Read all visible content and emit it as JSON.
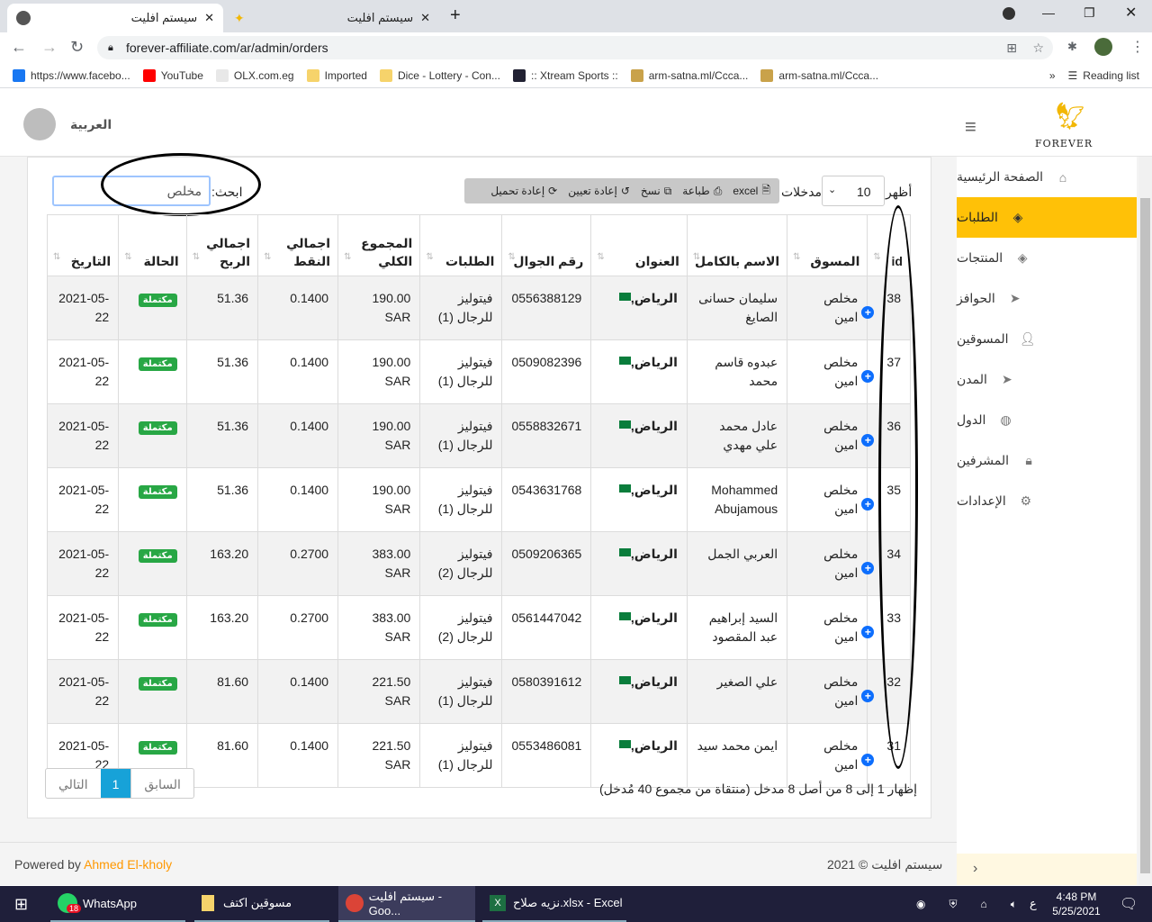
{
  "browser": {
    "tabs": [
      {
        "title": "سيستم افليت"
      },
      {
        "title": "سيستم افليت"
      }
    ],
    "url": "forever-affiliate.com/ar/admin/orders",
    "bookmarks": [
      "https://www.facebo...",
      "YouTube",
      "OLX.com.eg",
      "Imported",
      "Dice - Lottery - Con...",
      ":: Xtream Sports ::",
      "arm-satna.ml/Ccca...",
      "arm-satna.ml/Ccca..."
    ],
    "reading_list": "Reading list"
  },
  "header": {
    "language": "العربية",
    "logo_text": "FOREVER"
  },
  "sidebar": {
    "items": [
      "الصفحة الرئيسية",
      "الطلبات",
      "المنتجات",
      "الحوافز",
      "المسوقين",
      "المدن",
      "الدول",
      "المشرفين",
      "الإعدادات"
    ],
    "active_index": 1
  },
  "toolbar": {
    "show_label": "أظهر",
    "entries_value": "10",
    "entries_label": "مدخلات",
    "buttons": [
      "excel",
      "طباعة",
      "نسخ",
      "إعادة تعيين",
      "إعادة تحميل"
    ],
    "search_label": "ابحث:",
    "search_value": "مخلص"
  },
  "table": {
    "headers": [
      "id",
      "المسوق",
      "الاسم بالكامل",
      "العنوان",
      "رقم الجوال",
      "الطلبات",
      "المجموع الكلي",
      "اجمالي النقط",
      "اجمالي الربح",
      "الحالة",
      "التاريخ"
    ],
    "rows": [
      [
        "38",
        "مخلص امين",
        "سليمان حسانى الصايغ",
        "الرياض,",
        "0556388129",
        "فيتوليز للرجال (1)",
        "190.00 SAR",
        "0.1400",
        "51.36",
        "مكتملة",
        "2021-05-22"
      ],
      [
        "37",
        "مخلص امين",
        "عبدوه قاسم محمد",
        "الرياض,",
        "0509082396",
        "فيتوليز للرجال (1)",
        "190.00 SAR",
        "0.1400",
        "51.36",
        "مكتملة",
        "2021-05-22"
      ],
      [
        "36",
        "مخلص امين",
        "عادل محمد علي مهدي",
        "الرياض,",
        "0558832671",
        "فيتوليز للرجال (1)",
        "190.00 SAR",
        "0.1400",
        "51.36",
        "مكتملة",
        "2021-05-22"
      ],
      [
        "35",
        "مخلص امين",
        "Mohammed Abujamous",
        "الرياض,",
        "0543631768",
        "فيتوليز للرجال (1)",
        "190.00 SAR",
        "0.1400",
        "51.36",
        "مكتملة",
        "2021-05-22"
      ],
      [
        "34",
        "مخلص امين",
        "العربي الجمل",
        "الرياض,",
        "0509206365",
        "فيتوليز للرجال (2)",
        "383.00 SAR",
        "0.2700",
        "163.20",
        "مكتملة",
        "2021-05-22"
      ],
      [
        "33",
        "مخلص امين",
        "السيد إبراهيم عبد المقصود",
        "الرياض,",
        "0561447042",
        "فيتوليز للرجال (2)",
        "383.00 SAR",
        "0.2700",
        "163.20",
        "مكتملة",
        "2021-05-22"
      ],
      [
        "32",
        "مخلص امين",
        "علي الصغير",
        "الرياض,",
        "0580391612",
        "فيتوليز للرجال (1)",
        "221.50 SAR",
        "0.1400",
        "81.60",
        "مكتملة",
        "2021-05-22"
      ],
      [
        "31",
        "مخلص امين",
        "ايمن محمد سيد",
        "الرياض,",
        "0553486081",
        "فيتوليز للرجال (1)",
        "221.50 SAR",
        "0.1400",
        "81.60",
        "مكتملة",
        "2021-05-22"
      ]
    ]
  },
  "pagination": {
    "info": "إظهار 1 إلى 8 من أصل 8 مدخل (منتقاة من مجموع 40 مُدخل)",
    "prev": "السابق",
    "page": "1",
    "next": "التالي"
  },
  "footer": {
    "powered_by": "Powered by",
    "author": "Ahmed El-kholy",
    "copyright": "سيستم افليت © 2021"
  },
  "taskbar": {
    "apps": [
      "WhatsApp",
      "مسوقين اكتف",
      "سيستم افليت - Goo...",
      "نزيه صلاح.xlsx - Excel"
    ],
    "whatsapp_badge": "18",
    "time": "4:48 PM",
    "date": "5/25/2021",
    "lang": "ع"
  },
  "colors": {
    "accent": "#ffc107",
    "badge": "#28a745",
    "link": "#ff9800"
  }
}
